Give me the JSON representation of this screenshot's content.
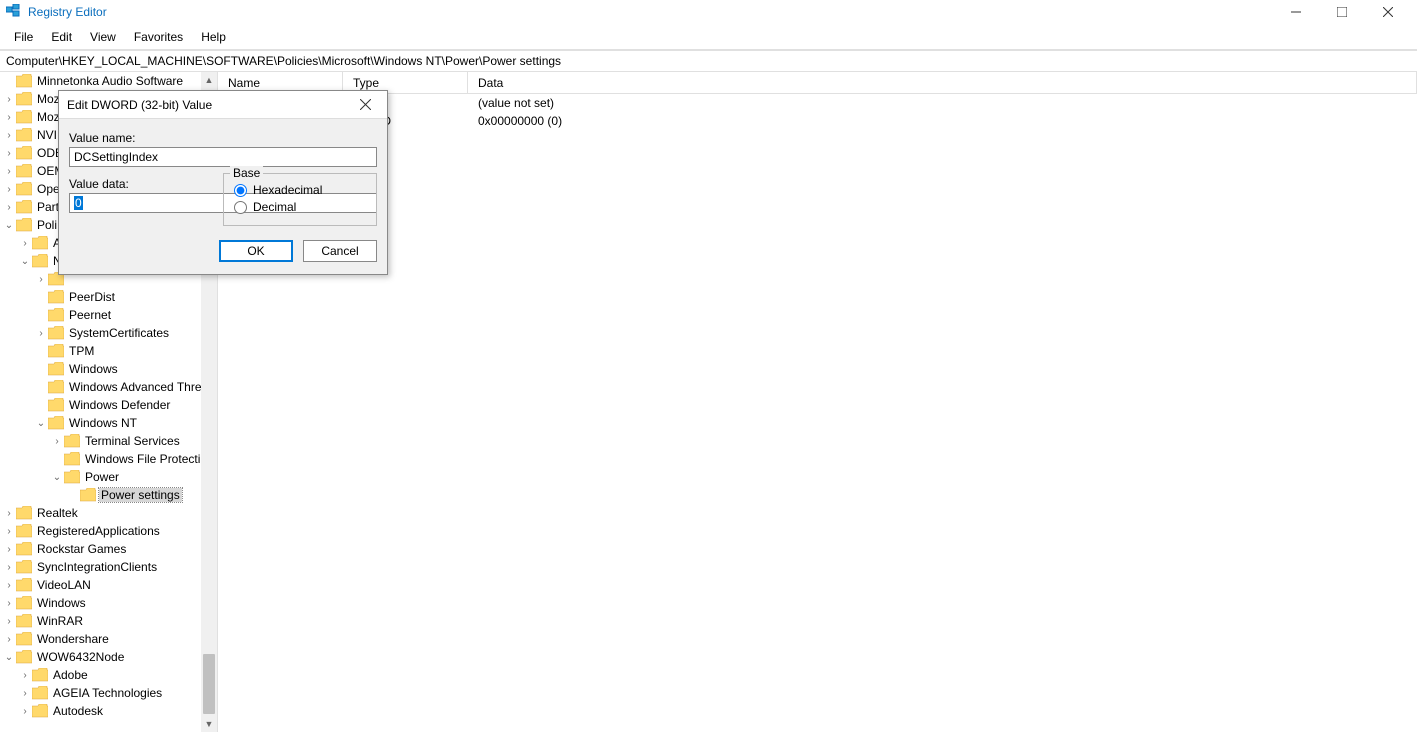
{
  "app": {
    "title": "Registry Editor"
  },
  "window_controls": {
    "min": "minimize",
    "max": "maximize",
    "close": "close"
  },
  "menu": [
    "File",
    "Edit",
    "View",
    "Favorites",
    "Help"
  ],
  "addressbar": "Computer\\HKEY_LOCAL_MACHINE\\SOFTWARE\\Policies\\Microsoft\\Windows NT\\Power\\Power settings",
  "columns": {
    "name": "Name",
    "type": "Type",
    "data": "Data"
  },
  "rows": [
    {
      "name": "",
      "type": "",
      "data": "(value not set)"
    },
    {
      "name": "",
      "type": "WORD",
      "data": "0x00000000 (0)"
    }
  ],
  "tree": [
    {
      "lvl": 0,
      "exp": "",
      "label": "Minnetonka Audio Software"
    },
    {
      "lvl": 0,
      "exp": ">",
      "label": "Moz"
    },
    {
      "lvl": 0,
      "exp": ">",
      "label": "Moz"
    },
    {
      "lvl": 0,
      "exp": ">",
      "label": "NVII"
    },
    {
      "lvl": 0,
      "exp": ">",
      "label": "ODE"
    },
    {
      "lvl": 0,
      "exp": ">",
      "label": "OEM"
    },
    {
      "lvl": 0,
      "exp": ">",
      "label": "Ope"
    },
    {
      "lvl": 0,
      "exp": ">",
      "label": "Part"
    },
    {
      "lvl": 0,
      "exp": "v",
      "label": "Poli"
    },
    {
      "lvl": 1,
      "exp": ">",
      "label": "A"
    },
    {
      "lvl": 1,
      "exp": "v",
      "label": "N"
    },
    {
      "lvl": 2,
      "exp": ">",
      "label": ""
    },
    {
      "lvl": 2,
      "exp": "",
      "label": "PeerDist"
    },
    {
      "lvl": 2,
      "exp": "",
      "label": "Peernet"
    },
    {
      "lvl": 2,
      "exp": ">",
      "label": "SystemCertificates"
    },
    {
      "lvl": 2,
      "exp": "",
      "label": "TPM"
    },
    {
      "lvl": 2,
      "exp": "",
      "label": "Windows"
    },
    {
      "lvl": 2,
      "exp": "",
      "label": "Windows Advanced Thre"
    },
    {
      "lvl": 2,
      "exp": "",
      "label": "Windows Defender"
    },
    {
      "lvl": 2,
      "exp": "v",
      "label": "Windows NT"
    },
    {
      "lvl": 3,
      "exp": ">",
      "label": "Terminal Services"
    },
    {
      "lvl": 3,
      "exp": "",
      "label": "Windows File Protecti"
    },
    {
      "lvl": 3,
      "exp": "v",
      "label": "Power"
    },
    {
      "lvl": 4,
      "exp": "",
      "label": "Power settings",
      "sel": true
    },
    {
      "lvl": 0,
      "exp": ">",
      "label": "Realtek"
    },
    {
      "lvl": 0,
      "exp": ">",
      "label": "RegisteredApplications"
    },
    {
      "lvl": 0,
      "exp": ">",
      "label": "Rockstar Games"
    },
    {
      "lvl": 0,
      "exp": ">",
      "label": "SyncIntegrationClients"
    },
    {
      "lvl": 0,
      "exp": ">",
      "label": "VideoLAN"
    },
    {
      "lvl": 0,
      "exp": ">",
      "label": "Windows"
    },
    {
      "lvl": 0,
      "exp": ">",
      "label": "WinRAR"
    },
    {
      "lvl": 0,
      "exp": ">",
      "label": "Wondershare"
    },
    {
      "lvl": 0,
      "exp": "v",
      "label": "WOW6432Node"
    },
    {
      "lvl": 1,
      "exp": ">",
      "label": "Adobe"
    },
    {
      "lvl": 1,
      "exp": ">",
      "label": "AGEIA Technologies"
    },
    {
      "lvl": 1,
      "exp": ">",
      "label": "Autodesk"
    }
  ],
  "dialog": {
    "title": "Edit DWORD (32-bit) Value",
    "value_name_label": "Value name:",
    "value_name": "DCSettingIndex",
    "value_data_label": "Value data:",
    "value_data": "0",
    "base_label": "Base",
    "base_options": {
      "hex": "Hexadecimal",
      "dec": "Decimal"
    },
    "base_selected": "hex",
    "ok": "OK",
    "cancel": "Cancel"
  }
}
